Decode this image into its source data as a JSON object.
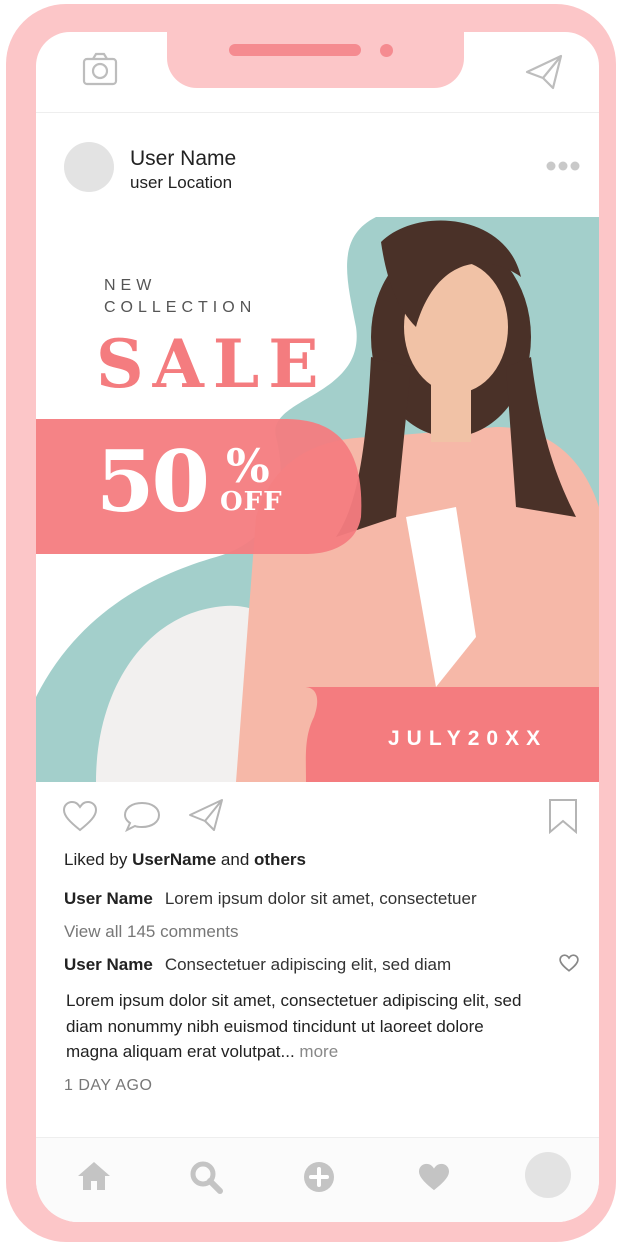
{
  "post": {
    "user_name": "User Name",
    "user_location": "user Location"
  },
  "promo": {
    "line1": "NEW",
    "line2": "COLLECTION",
    "headline": "SALE",
    "discount": "50",
    "percent": "%",
    "off": "OFF",
    "date": "JULY20XX"
  },
  "likes": {
    "prefix": "Liked by",
    "user": "UserName",
    "middle": "and",
    "others": "others"
  },
  "comments": [
    {
      "user": "User Name",
      "text": "Lorem ipsum dolor sit amet, consectetuer"
    },
    {
      "user": "User Name",
      "text": "Consectetuer adipiscing elit, sed diam"
    }
  ],
  "view_all": "View all 145 comments",
  "body_text": "Lorem ipsum dolor sit amet, consectetuer adipiscing elit, sed diam nonummy nibh euismod tincidunt ut laoreet dolore magna aliquam erat volutpat...",
  "more_label": "more",
  "time_ago": "1 DAY AGO",
  "icons": {
    "top_left": "camera-icon",
    "top_right": "send-icon",
    "more": "more-dots-icon",
    "like": "heart-icon",
    "comment": "comment-icon",
    "share": "send-icon",
    "save": "bookmark-icon",
    "nav": [
      "home-icon",
      "search-icon",
      "add-icon",
      "heart-icon"
    ]
  },
  "colors": {
    "phone_frame": "#fcc6c8",
    "accent_coral": "#f47c7f",
    "teal": "#a3cfcb",
    "icon_gray": "#bdbdbd"
  }
}
